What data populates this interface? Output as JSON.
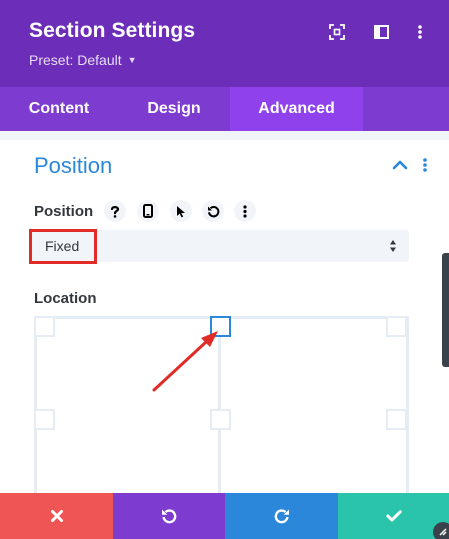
{
  "header": {
    "title": "Section Settings",
    "preset_label": "Preset: Default",
    "icons": [
      "expand-icon",
      "sidebar-toggle-icon",
      "more-vertical-icon"
    ]
  },
  "tabs": [
    {
      "label": "Content",
      "active": false
    },
    {
      "label": "Design",
      "active": false
    },
    {
      "label": "Advanced",
      "active": true
    }
  ],
  "section": {
    "title": "Position",
    "position_field": {
      "label": "Position",
      "option_icons": [
        "help-icon",
        "mobile-icon",
        "cursor-icon",
        "reset-icon",
        "more-vertical-icon"
      ],
      "value": "Fixed"
    },
    "location_field": {
      "label": "Location",
      "selected_handle": "top-center"
    }
  },
  "footer": {
    "buttons": [
      "close-icon",
      "undo-icon",
      "redo-icon",
      "check-icon"
    ]
  },
  "colors": {
    "header_bg": "#6c2eb9",
    "tabs_bg": "#7e3bd0",
    "active_tab_bg": "#8f42ec",
    "accent_blue": "#2b87da",
    "highlight_red": "#e02b27",
    "cancel_red": "#ef5555",
    "save_teal": "#29c4a9"
  }
}
